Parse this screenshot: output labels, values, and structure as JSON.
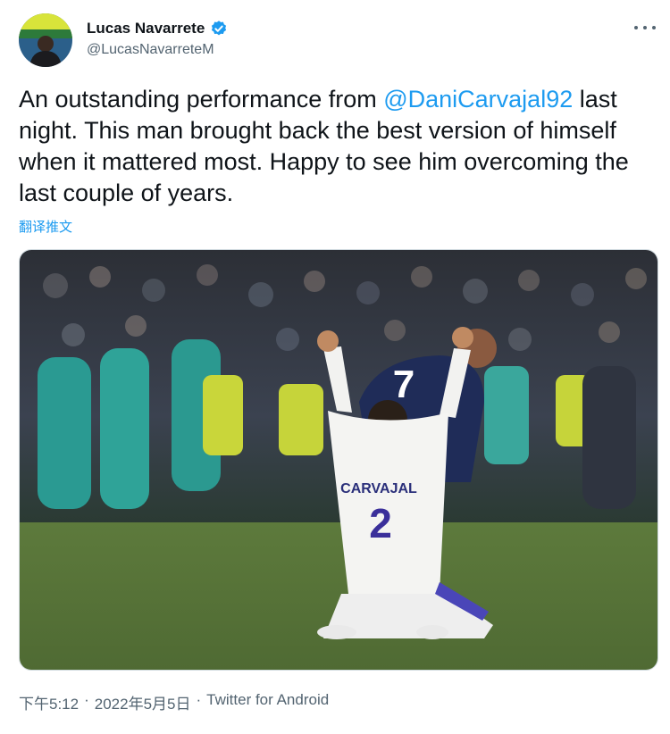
{
  "author": {
    "display_name": "Lucas Navarrete",
    "handle": "@LucasNavarreteM",
    "verified_icon": "verified-badge-icon",
    "accent_color": "#1d9bf0"
  },
  "tweet": {
    "text_before": "An outstanding performance from ",
    "mention": "@DaniCarvajal92",
    "text_after": " last night. This man brought back the best version of himself when it mattered most. Happy to see him overcoming the last couple of years.",
    "translate_label": "翻译推文"
  },
  "media": {
    "jersey_name": "CARVAJAL",
    "jersey_number": "2",
    "opponent_number": "7"
  },
  "footer": {
    "time": "下午5:12",
    "separator": "·",
    "date": "2022年5月5日",
    "source": "Twitter for Android"
  }
}
